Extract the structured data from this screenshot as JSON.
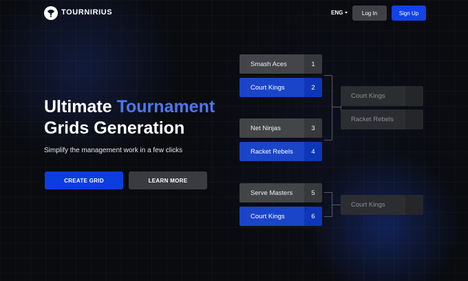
{
  "header": {
    "brand": "TOURNIRIUS",
    "language": "ENG",
    "login_label": "Log In",
    "signup_label": "Sign Up"
  },
  "hero": {
    "title_line1_prefix": "Ultimate ",
    "title_line1_accent": "Tournament",
    "title_line2": "Grids Generation",
    "subtitle": "Simplify the management work in a few clicks",
    "create_label": "CREATE GRID",
    "learn_label": "LEARN MORE"
  },
  "bracket": {
    "round1": [
      {
        "name": "Smash Aces",
        "seed": "1",
        "style": "gray"
      },
      {
        "name": "Court Kings",
        "seed": "2",
        "style": "blue"
      },
      {
        "name": "Net Ninjas",
        "seed": "3",
        "style": "gray"
      },
      {
        "name": "Racket Rebels",
        "seed": "4",
        "style": "blue"
      },
      {
        "name": "Serve Masters",
        "seed": "5",
        "style": "gray"
      },
      {
        "name": "Court Kings",
        "seed": "6",
        "style": "blue"
      }
    ],
    "round2": [
      {
        "name": "Court Kings"
      },
      {
        "name": "Racket Rebels"
      },
      {
        "name": "Court Kings"
      }
    ]
  },
  "colors": {
    "accent": "#4d77ef",
    "primary_button": "#0c3ddf",
    "signup_button": "#1242e8",
    "background": "#0a0b0f"
  }
}
